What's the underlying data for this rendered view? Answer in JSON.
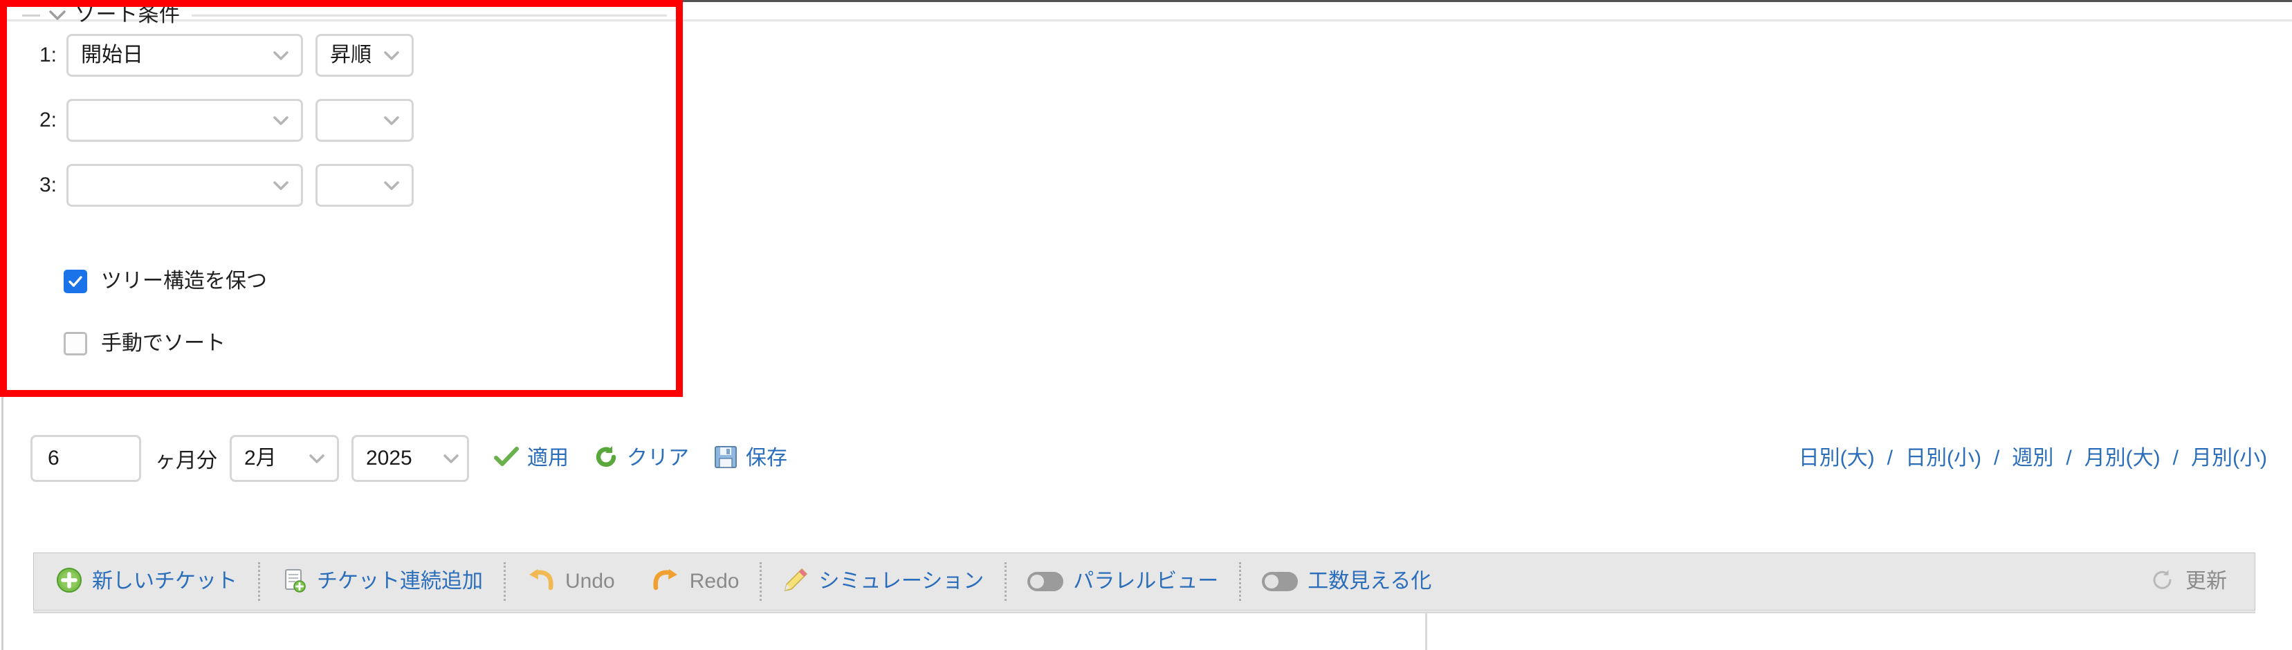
{
  "sort_panel": {
    "legend": "ソート条件",
    "collapse_icon": "chevron-down-icon",
    "rows": [
      {
        "index_label": "1:",
        "field_value": "開始日",
        "order_value": "昇順"
      },
      {
        "index_label": "2:",
        "field_value": "",
        "order_value": ""
      },
      {
        "index_label": "3:",
        "field_value": "",
        "order_value": ""
      }
    ],
    "checkboxes": [
      {
        "label": "ツリー構造を保つ",
        "checked": true
      },
      {
        "label": "手動でソート",
        "checked": false
      }
    ],
    "highlight_color": "#ff0000"
  },
  "period_row": {
    "months_value": "6",
    "months_placeholder": "",
    "months_unit": "ヶ月分",
    "month_value": "2月",
    "year_value": "2025",
    "actions": [
      {
        "label": "適用",
        "icon": "green-check-icon"
      },
      {
        "label": "クリア",
        "icon": "green-refresh-icon"
      },
      {
        "label": "保存",
        "icon": "floppy-disk-icon"
      }
    ],
    "link_color": "#2a6ebb"
  },
  "view_modes": {
    "separator": "/",
    "items": [
      {
        "label": "日別(大)"
      },
      {
        "label": "日別(小)"
      },
      {
        "label": "週別"
      },
      {
        "label": "月別(大)"
      },
      {
        "label": "月別(小)"
      }
    ]
  },
  "toolbar": {
    "background": "#e7e7e7",
    "items": [
      {
        "label": "新しいチケット",
        "icon": "green-plus-circle-icon",
        "state": "link"
      },
      {
        "label": "チケット連続追加",
        "icon": "document-add-icon",
        "state": "link"
      },
      {
        "label": "Undo",
        "icon": "undo-arrow-icon",
        "state": "muted"
      },
      {
        "label": "Redo",
        "icon": "redo-arrow-icon",
        "state": "muted"
      },
      {
        "label": "シミュレーション",
        "icon": "pencil-icon",
        "state": "link"
      },
      {
        "label": "パラレルビュー",
        "icon": "toggle-off-icon",
        "state": "link"
      },
      {
        "label": "工数見える化",
        "icon": "toggle-off-icon",
        "state": "link"
      },
      {
        "label": "更新",
        "icon": "refresh-circle-icon",
        "state": "muted"
      }
    ]
  }
}
